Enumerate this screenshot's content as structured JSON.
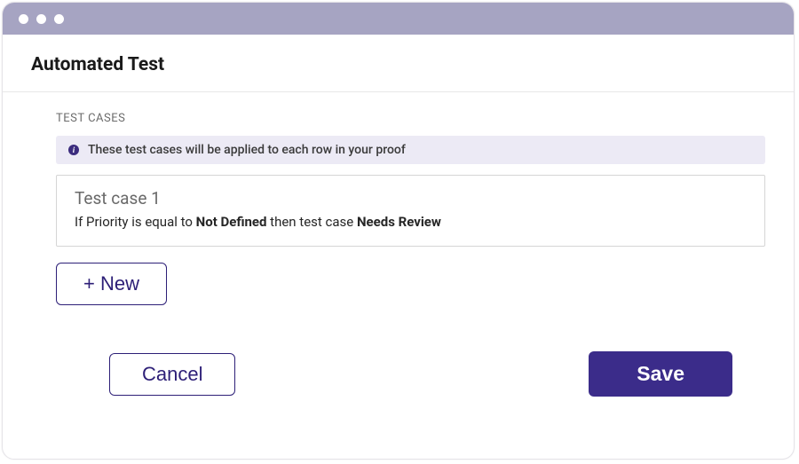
{
  "header": {
    "title": "Automated Test"
  },
  "section": {
    "label": "TEST CASES",
    "info": "These test cases will be applied to each row in your proof"
  },
  "testcases": [
    {
      "title": "Test case 1",
      "rule_prefix": "If Priority is equal to ",
      "rule_value": "Not Defined",
      "rule_mid": " then test case ",
      "rule_result": "Needs Review"
    }
  ],
  "buttons": {
    "new": "+ New",
    "cancel": "Cancel",
    "save": "Save"
  }
}
